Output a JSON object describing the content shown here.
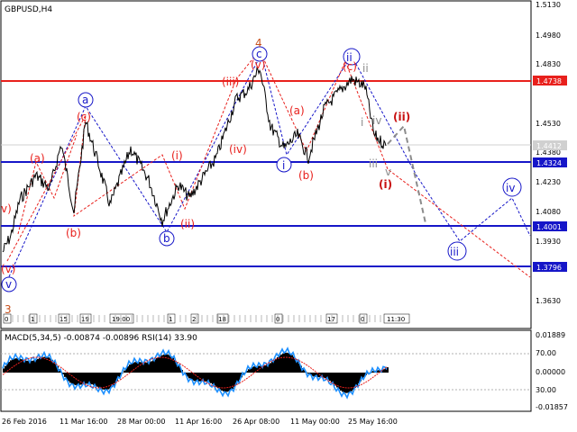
{
  "window": {
    "title": "GBPUSD,H4"
  },
  "colors": {
    "blue": "#1616c8",
    "red": "#e8201c",
    "gray": "#8c8c8c",
    "black": "#000000",
    "price_marker": "#d0d0d0"
  },
  "price_axis": {
    "ticks": [
      "1.5130",
      "1.4980",
      "1.4830",
      "1.4530",
      "1.4380",
      "1.4230",
      "1.4080",
      "1.3930",
      "1.3630"
    ],
    "badges": {
      "level_red": "1.4738",
      "current": "1.4412",
      "level_blue_upper": "1.4324",
      "level_blue_mid": "1.4001",
      "level_blue_low": "1.3796"
    }
  },
  "time_axis": {
    "labels": [
      "26 Feb 2016",
      "11 Mar 16:00",
      "28 Mar 00:00",
      "11 Apr 16:00",
      "26 Apr 08:00",
      "11 May 00:00",
      "25 May 16:00"
    ]
  },
  "wave_labels": {
    "blue": {
      "a": "a",
      "b": "b",
      "c": "c",
      "ii": "ii",
      "i_mark": "i",
      "v": "v",
      "iii": "iii",
      "iv": "iv"
    },
    "red": {
      "four": "4",
      "three": "3",
      "v_top": "(v)",
      "iii_top": "(iii)",
      "iv_mid": "(iv)",
      "c_left": "(c)",
      "a_left": "(a)",
      "b_left": "(b)",
      "i_left": "(i)",
      "ii_left": "(ii)",
      "a_mid": "(a)",
      "b_mid": "(b)",
      "c_top": "(c)",
      "ii_fore": "(ii)",
      "i_fore": "(i)",
      "v_edge": "v)",
      "v_bottom": "(v)"
    },
    "gray": {
      "ii": "ii",
      "i": "i",
      "iv": "iv",
      "iii": "iii",
      "v": "v"
    }
  },
  "timebar": {
    "segments": [
      "0",
      "1",
      "15",
      "19",
      "19:00",
      "1",
      "2",
      "18",
      "0",
      "17",
      "0",
      "11:30"
    ]
  },
  "indicator": {
    "title": "MACD(5,34,5) -0.00874 -0.00896 RSI(14) 33.90",
    "axis": [
      "0.01889",
      "70.00",
      "0.00000",
      "30.00",
      "-0.01857"
    ]
  }
}
